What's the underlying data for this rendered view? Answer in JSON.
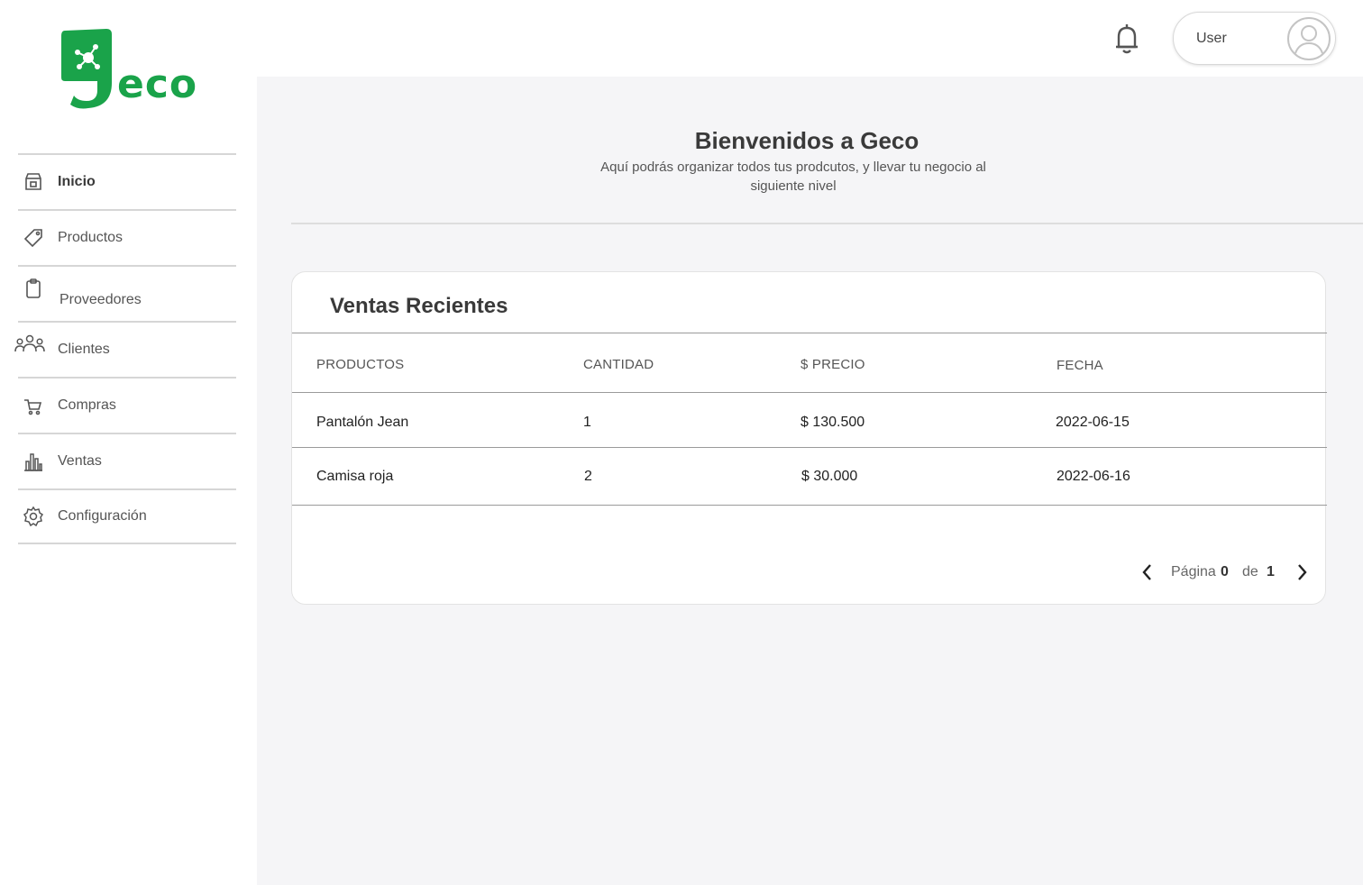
{
  "brand": {
    "name": "eco",
    "color": "#1aa34a"
  },
  "sidebar": {
    "items": [
      {
        "label": "Inicio",
        "icon": "store-icon",
        "active": true
      },
      {
        "label": "Productos",
        "icon": "tag-icon",
        "active": false
      },
      {
        "label": "Proveedores",
        "icon": "clipboard-icon",
        "active": false
      },
      {
        "label": "Clientes",
        "icon": "users-icon",
        "active": false
      },
      {
        "label": "Compras",
        "icon": "cart-icon",
        "active": false
      },
      {
        "label": "Ventas",
        "icon": "bar-chart-icon",
        "active": false
      },
      {
        "label": "Configuración",
        "icon": "gear-icon",
        "active": false
      }
    ]
  },
  "header": {
    "notification_icon": "bell-icon",
    "user_label": "User",
    "avatar_icon": "user-circle-icon"
  },
  "main": {
    "title": "Bienvenidos a Geco",
    "subtitle": "Aquí podrás organizar todos tus prodcutos, y llevar tu negocio al siguiente nivel"
  },
  "sales": {
    "title": "Ventas Recientes",
    "columns": [
      "PRODUCTOS",
      "CANTIDAD",
      "$ PRECIO",
      "FECHA"
    ],
    "rows": [
      [
        "Pantalón Jean",
        "1",
        "$ 130.500",
        "2022-06-15"
      ],
      [
        "Camisa roja",
        "2",
        "$ 30.000",
        "2022-06-16"
      ]
    ],
    "pagination": {
      "page_label": "Página",
      "current": "0",
      "of_label": "de",
      "total": "1",
      "prev_icon": "chevron-left-icon",
      "next_icon": "chevron-right-icon"
    }
  }
}
